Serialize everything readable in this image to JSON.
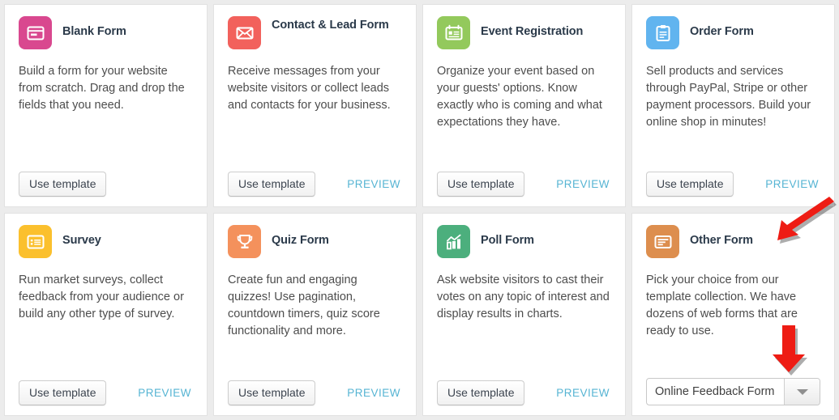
{
  "theme": {
    "page_background": "#ececec",
    "card_background": "#ffffff",
    "card_border": "#e2e2e2",
    "title_color": "#2b3a4a",
    "body_color": "#4d4d4d",
    "preview_link_color": "#56b4d3",
    "annotation_arrow_color": "#ee1c14"
  },
  "labels": {
    "use_template": "Use template",
    "preview": "PREVIEW"
  },
  "cards": [
    {
      "id": "blank-form",
      "title": "Blank Form",
      "title_lines": 1,
      "description": "Build a form for your website from scratch. Drag and drop the fields that you need.",
      "icon": "window-icon",
      "icon_color": "#d9488f",
      "use_template_label": "Use template",
      "has_preview": false,
      "preview_label": "",
      "has_select": false
    },
    {
      "id": "contact-lead-form",
      "title": "Contact & Lead Form",
      "title_lines": 2,
      "description": "Receive messages from your website visitors or collect leads and contacts for your business.",
      "icon": "envelope-icon",
      "icon_color": "#f2615c",
      "use_template_label": "Use template",
      "has_preview": true,
      "preview_label": "PREVIEW",
      "has_select": false
    },
    {
      "id": "event-registration",
      "title": "Event Registration",
      "title_lines": 1,
      "description": "Organize your event based on your guests' options. Know exactly who is coming and what expectations they have.",
      "icon": "calendar-card-icon",
      "icon_color": "#93c95c",
      "use_template_label": "Use template",
      "has_preview": true,
      "preview_label": "PREVIEW",
      "has_select": false
    },
    {
      "id": "order-form",
      "title": "Order Form",
      "title_lines": 1,
      "description": "Sell products and services through PayPal, Stripe or other payment processors. Build your online shop in minutes!",
      "icon": "clipboard-icon",
      "icon_color": "#61b4ef",
      "use_template_label": "Use template",
      "has_preview": true,
      "preview_label": "PREVIEW",
      "has_select": false
    },
    {
      "id": "survey",
      "title": "Survey",
      "title_lines": 1,
      "description": "Run market surveys, collect feedback from your audience or build any other type of survey.",
      "icon": "list-document-icon",
      "icon_color": "#fbc02d",
      "use_template_label": "Use template",
      "has_preview": true,
      "preview_label": "PREVIEW",
      "has_select": false
    },
    {
      "id": "quiz-form",
      "title": "Quiz Form",
      "title_lines": 1,
      "description": "Create fun and engaging quizzes! Use pagination, countdown timers, quiz score functionality and more.",
      "icon": "trophy-icon",
      "icon_color": "#f4915c",
      "use_template_label": "Use template",
      "has_preview": true,
      "preview_label": "PREVIEW",
      "has_select": false
    },
    {
      "id": "poll-form",
      "title": "Poll Form",
      "title_lines": 1,
      "description": "Ask website visitors to cast their votes on any topic of interest and display results in charts.",
      "icon": "bar-chart-icon",
      "icon_color": "#4caf7d",
      "use_template_label": "Use template",
      "has_preview": true,
      "preview_label": "PREVIEW",
      "has_select": false
    },
    {
      "id": "other-form",
      "title": "Other Form",
      "title_lines": 1,
      "description": "Pick your choice from our template collection. We have dozens of web forms that are ready to use.",
      "icon": "text-card-icon",
      "icon_color": "#dd8e4e",
      "use_template_label": "",
      "has_preview": false,
      "preview_label": "",
      "has_select": true,
      "select_value": "Online Feedback Form",
      "annotations": [
        "diagonal-arrow-to-title",
        "down-arrow-to-select"
      ]
    }
  ]
}
